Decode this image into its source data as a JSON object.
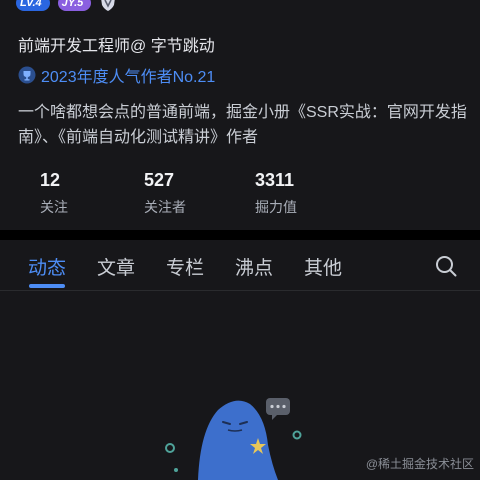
{
  "badges": {
    "level": "LV.4",
    "jy": "JY.5"
  },
  "bio_title": "前端开发工程师@ 字节跳动",
  "honor": "2023年度人气作者No.21",
  "description": "一个啥都想会点的普通前端，掘金小册《SSR实战：官网开发指南》、《前端自动化测试精讲》作者",
  "stats": [
    {
      "value": "12",
      "label": "关注"
    },
    {
      "value": "527",
      "label": "关注者"
    },
    {
      "value": "3311",
      "label": "掘力值"
    }
  ],
  "tabs": [
    {
      "label": "动态",
      "active": true
    },
    {
      "label": "文章",
      "active": false
    },
    {
      "label": "专栏",
      "active": false
    },
    {
      "label": "沸点",
      "active": false
    },
    {
      "label": "其他",
      "active": false
    }
  ],
  "watermark": "@稀土掘金技术社区",
  "colors": {
    "accent": "#4d8df5",
    "background": "#17171a",
    "level_badge": "#2a66e0",
    "jy_badge": "#8a5fe0"
  },
  "icons": [
    "level-badge-icon",
    "jy-badge-icon",
    "shield-icon",
    "trophy-icon",
    "search-icon",
    "empty-state-illustration"
  ]
}
